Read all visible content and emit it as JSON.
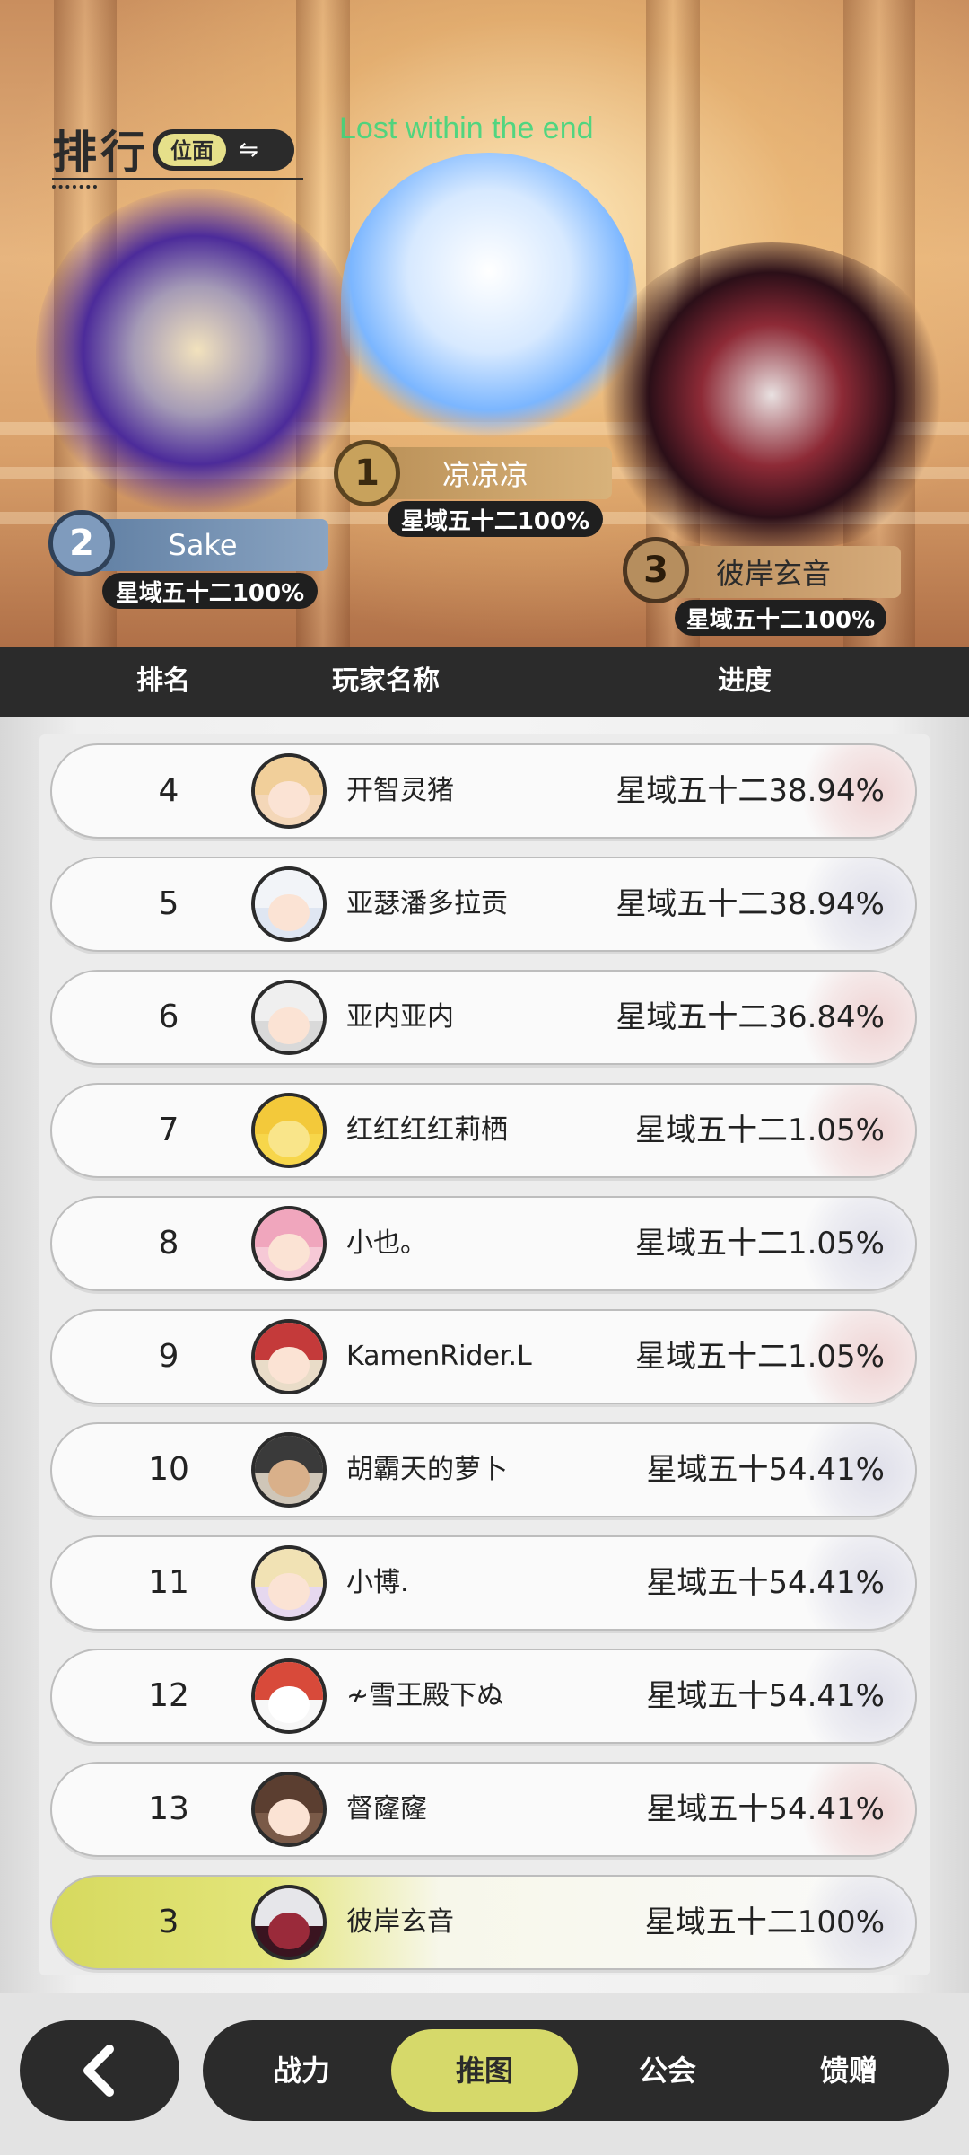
{
  "header": {
    "title": "排行",
    "facet_label": "位面",
    "facet_icon": "swap-arrows-icon",
    "banner_text": "Lost within the end"
  },
  "podium": [
    {
      "rank": "1",
      "name": "凉凉凉",
      "progress": "星域五十二100%"
    },
    {
      "rank": "2",
      "name": "Sake",
      "progress": "星域五十二100%"
    },
    {
      "rank": "3",
      "name": "彼岸玄音",
      "progress": "星域五十二100%"
    }
  ],
  "columns": {
    "rank": "排名",
    "name": "玩家名称",
    "progress": "进度"
  },
  "rows": [
    {
      "rank": "4",
      "name": "开智灵猪",
      "progress": "星域五十二38.94%"
    },
    {
      "rank": "5",
      "name": "亚瑟潘多拉贡",
      "progress": "星域五十二38.94%"
    },
    {
      "rank": "6",
      "name": "亚内亚内",
      "progress": "星域五十二36.84%"
    },
    {
      "rank": "7",
      "name": "红红红红莉栖",
      "progress": "星域五十二1.05%"
    },
    {
      "rank": "8",
      "name": "小也。",
      "progress": "星域五十二1.05%"
    },
    {
      "rank": "9",
      "name": "KamenRider.L",
      "progress": "星域五十二1.05%"
    },
    {
      "rank": "10",
      "name": "胡霸天的萝卜",
      "progress": "星域五十54.41%"
    },
    {
      "rank": "11",
      "name": "小博.",
      "progress": "星域五十54.41%"
    },
    {
      "rank": "12",
      "name": "≁雪王殿下ぬ",
      "progress": "星域五十54.41%"
    },
    {
      "rank": "13",
      "name": "督窿窿",
      "progress": "星域五十54.41%"
    }
  ],
  "my_row": {
    "rank": "3",
    "name": "彼岸玄音",
    "progress": "星域五十二100%"
  },
  "nav": {
    "back_icon": "chevron-left-icon",
    "tabs": [
      {
        "label": "战力"
      },
      {
        "label": "推图",
        "active": true
      },
      {
        "label": "公会"
      },
      {
        "label": "馈赠"
      }
    ]
  },
  "colors": {
    "accent": "#d6d96a",
    "dark": "#2b2b2b",
    "banner_green": "#36d77c"
  }
}
